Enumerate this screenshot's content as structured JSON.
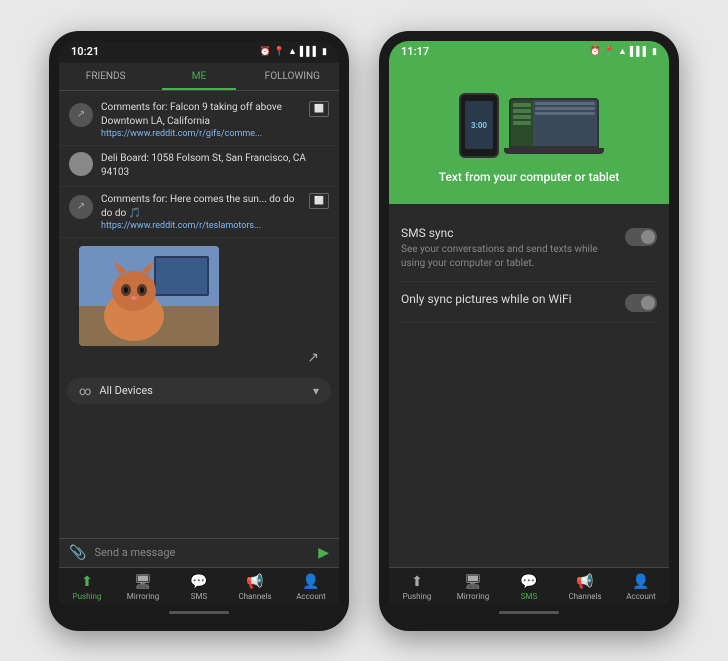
{
  "page": {
    "background": "#e8e8e8"
  },
  "phone1": {
    "status_time": "10:21",
    "status_icons": [
      "alarm",
      "location",
      "wifi",
      "signal",
      "battery"
    ],
    "tabs": [
      "FRIENDS",
      "ME",
      "FOLLOWING"
    ],
    "active_tab": "ME",
    "messages": [
      {
        "type": "share",
        "text": "Comments for: Falcon 9 taking off above Downtown LA, California",
        "link": "https://www.reddit.com/r/gifs/comme...",
        "has_device": true
      },
      {
        "type": "avatar",
        "text": "Deli Board: 1058 Folsom St, San Francisco, CA 94103",
        "has_device": false
      },
      {
        "type": "share",
        "text": "Comments for: Here comes the sun... do do do do 🎵",
        "link": "https://www.reddit.com/r/teslamotors...",
        "has_device": true
      }
    ],
    "devices_label": "All Devices",
    "input_placeholder": "Send a message",
    "nav_items": [
      {
        "label": "Pushing",
        "active": true
      },
      {
        "label": "Mirroring",
        "active": false
      },
      {
        "label": "SMS",
        "active": false
      },
      {
        "label": "Channels",
        "active": false
      },
      {
        "label": "Account",
        "active": false
      }
    ]
  },
  "phone2": {
    "status_time": "11:17",
    "illus_time": "3:00",
    "sms_header_title": "Text from your computer or tablet",
    "settings": [
      {
        "title": "SMS sync",
        "desc": "See your conversations and send texts while using your computer or tablet.",
        "enabled": false
      },
      {
        "title": "Only sync pictures while on WiFi",
        "desc": "",
        "enabled": false
      }
    ],
    "nav_items": [
      {
        "label": "Pushing",
        "active": false
      },
      {
        "label": "Mirroring",
        "active": false
      },
      {
        "label": "SMS",
        "active": true
      },
      {
        "label": "Channels",
        "active": false
      },
      {
        "label": "Account",
        "active": false
      }
    ]
  }
}
